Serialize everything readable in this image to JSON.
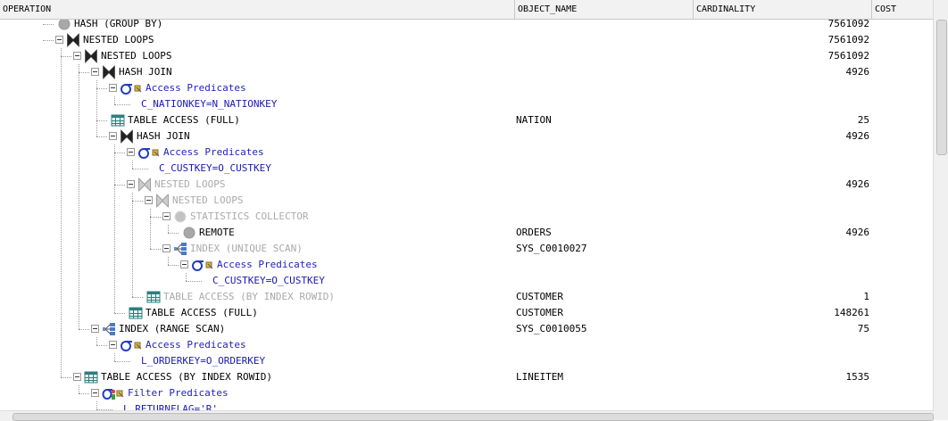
{
  "columns": {
    "operation": "OPERATION",
    "object_name": "OBJECT_NAME",
    "cardinality": "CARDINALITY",
    "cost": "COST"
  },
  "rows": [
    {
      "depth": 3,
      "icon": "circle-icon",
      "label": "HASH (GROUP BY)",
      "style": "normal",
      "object": "",
      "cardinality": "7561092"
    },
    {
      "depth": 3,
      "icon": "join-icon",
      "label": "NESTED LOOPS",
      "style": "normal",
      "object": "",
      "cardinality": "7561092"
    },
    {
      "depth": 4,
      "icon": "join-icon",
      "label": "NESTED LOOPS",
      "style": "normal",
      "object": "",
      "cardinality": "7561092"
    },
    {
      "depth": 5,
      "icon": "join-icon",
      "label": "HASH JOIN",
      "style": "normal",
      "object": "",
      "cardinality": "4926"
    },
    {
      "depth": 6,
      "icon": "sigma-icon",
      "label": "Access Predicates",
      "style": "pred",
      "object": "",
      "cardinality": ""
    },
    {
      "depth": 7,
      "icon": "",
      "label": "C_NATIONKEY=N_NATIONKEY",
      "style": "expr",
      "object": "",
      "cardinality": ""
    },
    {
      "depth": 6,
      "icon": "table-icon",
      "label": "TABLE ACCESS (FULL)",
      "style": "normal",
      "object": "NATION",
      "cardinality": "25"
    },
    {
      "depth": 6,
      "icon": "join-icon",
      "label": "HASH JOIN",
      "style": "normal",
      "object": "",
      "cardinality": "4926"
    },
    {
      "depth": 7,
      "icon": "sigma-icon",
      "label": "Access Predicates",
      "style": "pred",
      "object": "",
      "cardinality": ""
    },
    {
      "depth": 8,
      "icon": "",
      "label": "C_CUSTKEY=O_CUSTKEY",
      "style": "expr",
      "object": "",
      "cardinality": ""
    },
    {
      "depth": 7,
      "icon": "join-icon",
      "label": "NESTED LOOPS",
      "style": "gray",
      "object": "",
      "cardinality": "4926"
    },
    {
      "depth": 8,
      "icon": "join-icon",
      "label": "NESTED LOOPS",
      "style": "gray",
      "object": "",
      "cardinality": ""
    },
    {
      "depth": 9,
      "icon": "circle-icon",
      "label": "STATISTICS COLLECTOR",
      "style": "gray",
      "object": "",
      "cardinality": ""
    },
    {
      "depth": 10,
      "icon": "circle-icon",
      "label": "REMOTE",
      "style": "normal",
      "object": "ORDERS",
      "cardinality": "4926"
    },
    {
      "depth": 9,
      "icon": "index-icon",
      "label": "INDEX (UNIQUE SCAN)",
      "style": "gray",
      "object": "SYS_C0010027",
      "cardinality": ""
    },
    {
      "depth": 10,
      "icon": "sigma-icon",
      "label": "Access Predicates",
      "style": "pred",
      "object": "",
      "cardinality": ""
    },
    {
      "depth": 11,
      "icon": "",
      "label": "C_CUSTKEY=O_CUSTKEY",
      "style": "expr",
      "object": "",
      "cardinality": ""
    },
    {
      "depth": 8,
      "icon": "table-icon",
      "label": "TABLE ACCESS (BY INDEX ROWID)",
      "style": "gray",
      "object": "CUSTOMER",
      "cardinality": "1"
    },
    {
      "depth": 7,
      "icon": "table-icon",
      "label": "TABLE ACCESS (FULL)",
      "style": "normal",
      "object": "CUSTOMER",
      "cardinality": "148261"
    },
    {
      "depth": 5,
      "icon": "index-icon",
      "label": "INDEX (RANGE SCAN)",
      "style": "normal",
      "object": "SYS_C0010055",
      "cardinality": "75"
    },
    {
      "depth": 6,
      "icon": "sigma-icon",
      "label": "Access Predicates",
      "style": "pred",
      "object": "",
      "cardinality": ""
    },
    {
      "depth": 7,
      "icon": "",
      "label": "L_ORDERKEY=O_ORDERKEY",
      "style": "expr",
      "object": "",
      "cardinality": ""
    },
    {
      "depth": 4,
      "icon": "table-icon",
      "label": "TABLE ACCESS (BY INDEX ROWID)",
      "style": "normal",
      "object": "LINEITEM",
      "cardinality": "1535"
    },
    {
      "depth": 5,
      "icon": "filter-icon",
      "label": "Filter Predicates",
      "style": "pred",
      "object": "",
      "cardinality": ""
    },
    {
      "depth": 6,
      "icon": "",
      "label": "L_RETURNFLAG='R'",
      "style": "expr",
      "object": "",
      "cardinality": ""
    }
  ]
}
